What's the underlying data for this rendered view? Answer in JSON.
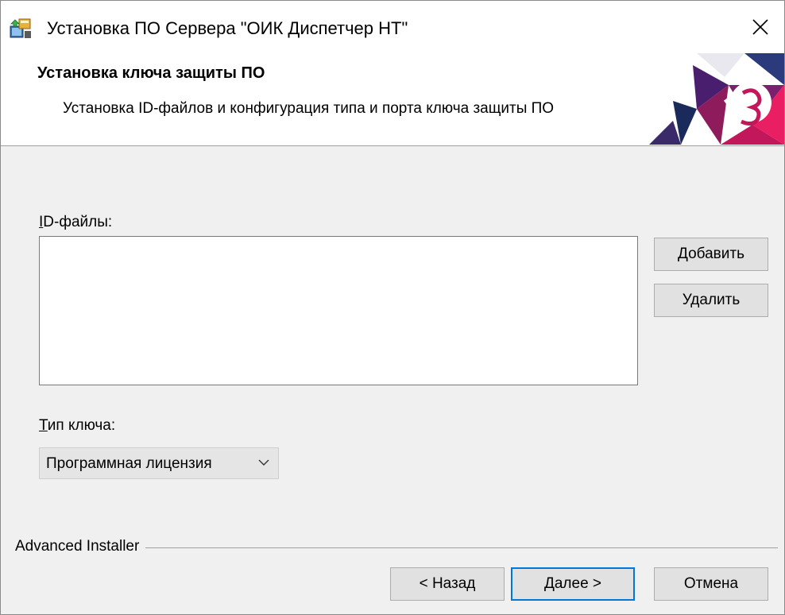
{
  "window": {
    "title": "Установка ПО Сервера \"ОИК Диспетчер НТ\"",
    "icons": {
      "app": "installer-icon",
      "close": "close-icon"
    }
  },
  "header": {
    "title": "Установка ключа защиты ПО",
    "subtitle": "Установка ID-файлов и конфигурация типа и порта ключа защиты ПО",
    "banner_colors": [
      "#5b1a6e",
      "#c2185b",
      "#e91e63",
      "#1a2a5a"
    ]
  },
  "id_files": {
    "label_accel": "I",
    "label_rest": "D-файлы:",
    "items": [],
    "add_label": "Добавить",
    "remove_label": "Удалить"
  },
  "key_type": {
    "label_accel": "Т",
    "label_rest": "ип ключа:",
    "selected": "Программная лицензия"
  },
  "footer": {
    "brand": "Advanced Installer",
    "back_label": "< Назад",
    "next_label": "Далее >",
    "cancel_label": "Отмена",
    "accent_color": "#0078d7"
  }
}
